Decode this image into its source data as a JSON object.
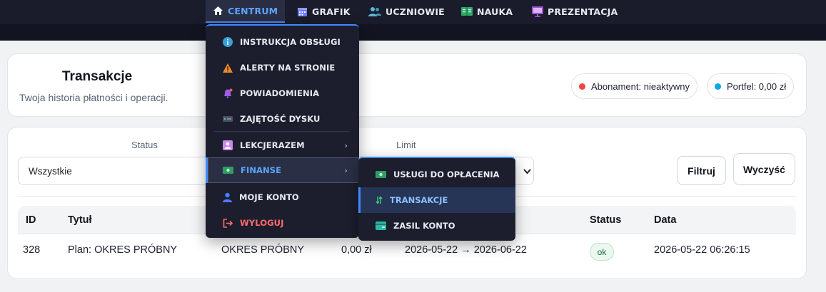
{
  "nav": {
    "items": [
      {
        "label": "CENTRUM",
        "icon": "home-icon"
      },
      {
        "label": "GRAFIK",
        "icon": "calendar-icon"
      },
      {
        "label": "UCZNIOWIE",
        "icon": "users-icon"
      },
      {
        "label": "NAUKA",
        "icon": "book-icon"
      },
      {
        "label": "PREZENTACJA",
        "icon": "presentation-icon"
      }
    ]
  },
  "header": {
    "title": "Transakcje",
    "subtitle": "Twoja historia płatności i operacji.",
    "subscription": "Abonament: nieaktywny",
    "wallet": "Portfel: 0,00 zł"
  },
  "filters": {
    "status_label": "Status",
    "status_value": "Wszystkie",
    "limit_label": "Limit",
    "filter_button": "Filtruj",
    "clear_button": "Wyczyść"
  },
  "table": {
    "headers": [
      "ID",
      "Tytuł",
      "Status",
      "Data"
    ],
    "rows": [
      {
        "id": "328",
        "title": "Plan: OKRES PRÓBNY",
        "type": "OKRES PRÓBNY",
        "amount": "0,00 zł",
        "period": "2026-05-22 → 2026-06-22",
        "status": "ok",
        "date": "2026-05-22 06:26:15"
      }
    ]
  },
  "menu": {
    "items": [
      {
        "label": "INSTRUKCJA OBSŁUGI",
        "icon": "info-icon"
      },
      {
        "label": "ALERTY NA STRONIE",
        "icon": "warning-icon"
      },
      {
        "label": "POWIADOMIENIA",
        "icon": "bell-icon"
      },
      {
        "label": "ZAJĘTOŚĆ DYSKU",
        "icon": "disk-icon"
      },
      {
        "label": "LEKCJERAZEM",
        "icon": "user-card-icon"
      },
      {
        "label": "FINANSE",
        "icon": "money-icon"
      },
      {
        "label": "MOJE KONTO",
        "icon": "user-icon"
      },
      {
        "label": "WYLOGUJ",
        "icon": "logout-icon"
      }
    ],
    "arrow": "›"
  },
  "submenu": {
    "items": [
      {
        "label": "USŁUGI DO OPŁACENIA",
        "icon": "money-icon"
      },
      {
        "label": "TRANSAKCJE",
        "icon": "exchange-icon"
      },
      {
        "label": "ZASIL KONTO",
        "icon": "wallet-icon"
      }
    ]
  },
  "colors": {
    "accent": "#3d8bff",
    "topbar": "#1a1c2b",
    "menu_bg": "#1c1e2e",
    "danger": "#ff6b6b",
    "subscription_dot": "#ef4444",
    "wallet_dot": "#0ea5e9"
  }
}
